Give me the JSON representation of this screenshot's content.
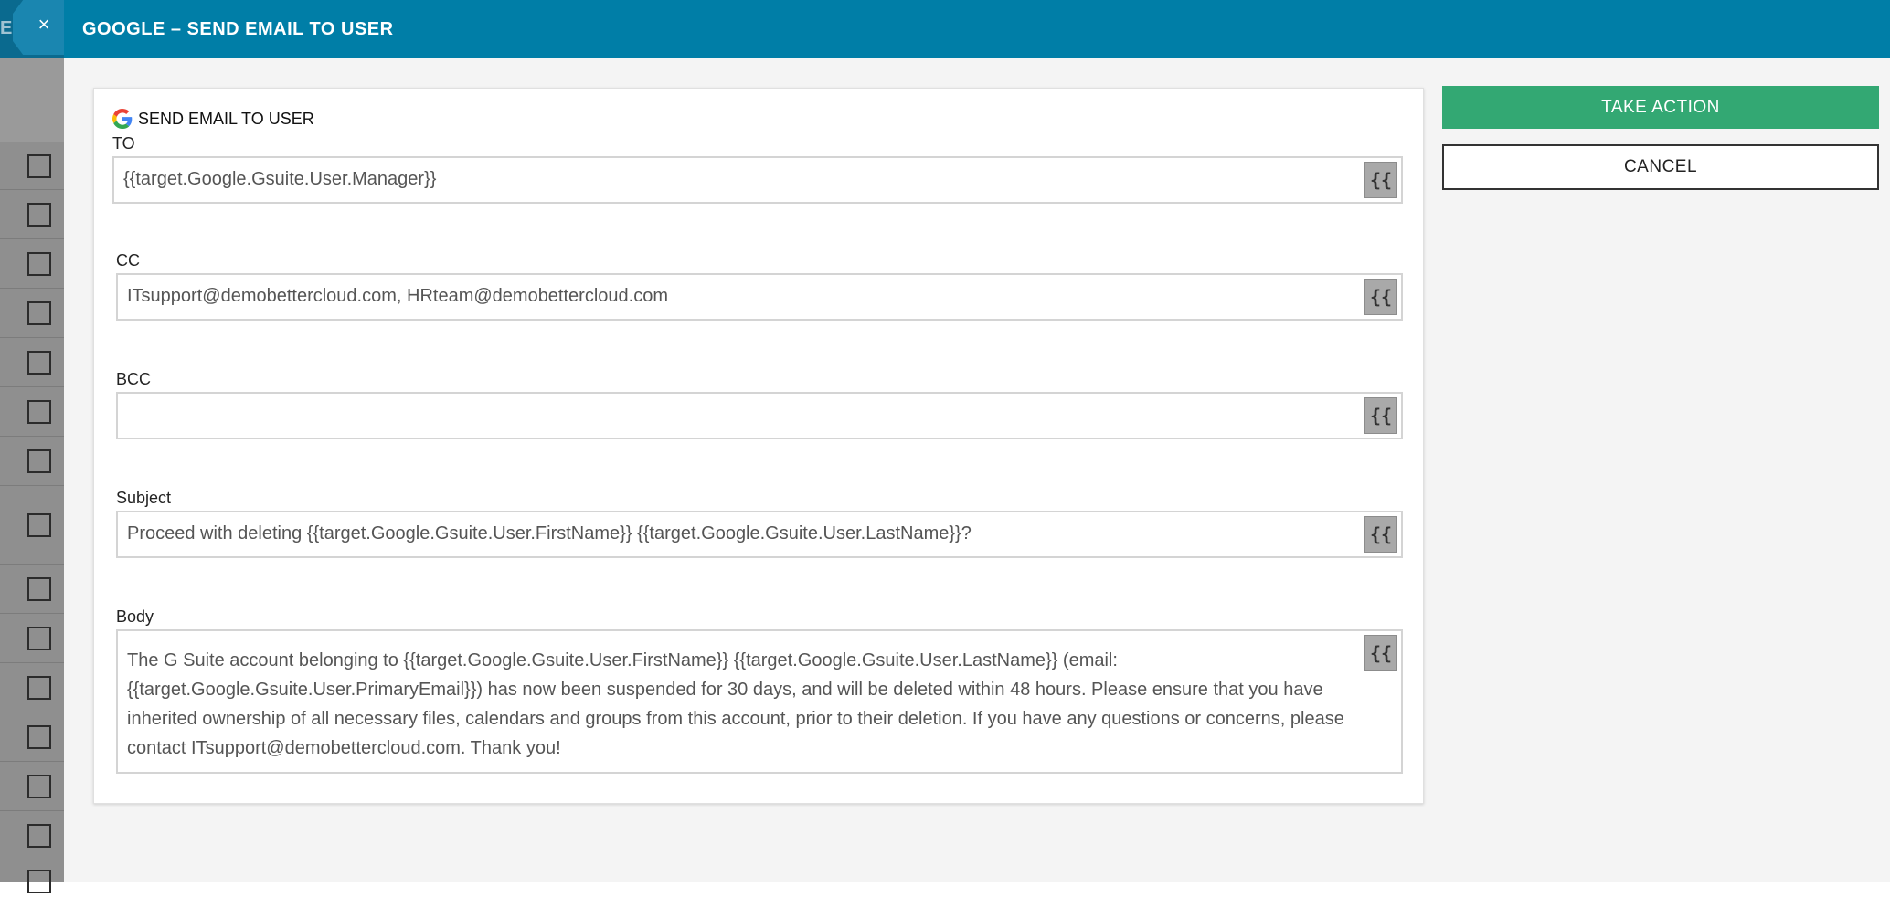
{
  "background": {
    "header_text": "ER"
  },
  "modal": {
    "close_symbol": "×",
    "title": "GOOGLE – SEND EMAIL TO USER"
  },
  "form": {
    "heading": "SEND EMAIL TO USER",
    "icon": "google-icon",
    "variable_button_label": "{{",
    "to": {
      "label": "TO",
      "value": "{{target.Google.Gsuite.User.Manager}}"
    },
    "cc": {
      "label": "CC",
      "value": "ITsupport@demobettercloud.com, HRteam@demobettercloud.com"
    },
    "bcc": {
      "label": "BCC",
      "value": ""
    },
    "subject": {
      "label": "Subject",
      "value": "Proceed with deleting {{target.Google.Gsuite.User.FirstName}} {{target.Google.Gsuite.User.LastName}}?"
    },
    "body": {
      "label": "Body",
      "value": "The G Suite account belonging to {{target.Google.Gsuite.User.FirstName}} {{target.Google.Gsuite.User.LastName}} (email:  {{target.Google.Gsuite.User.PrimaryEmail}}) has now been suspended for 30 days, and will be deleted within 48 hours. Please ensure that you have inherited ownership of all necessary files, calendars and groups from this account, prior to their deletion. If you have any questions or concerns, please contact ITsupport@demobettercloud.com. Thank you!"
    }
  },
  "actions": {
    "take_action": "TAKE ACTION",
    "cancel": "CANCEL"
  },
  "colors": {
    "header": "#007ea7",
    "take_action": "#33a873"
  }
}
